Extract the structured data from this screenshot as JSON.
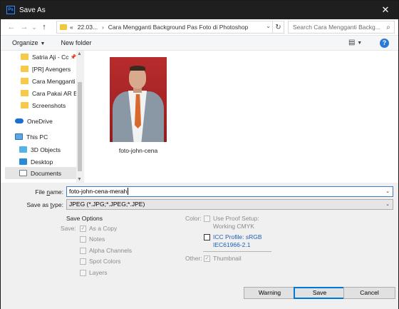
{
  "window": {
    "title": "Save As",
    "app_icon": "Ps",
    "close_glyph": "✕"
  },
  "nav": {
    "back_glyph": "←",
    "forward_glyph": "→",
    "recent_glyph": "⌄",
    "up_glyph": "↑",
    "breadcrumb": [
      "«",
      "22.03...",
      "Cara Mengganti Background Pas Foto di Photoshop"
    ],
    "search_placeholder": "Search Cara Mengganti Backg..."
  },
  "toolbar": {
    "organize_label": "Organize",
    "new_folder_label": "New folder"
  },
  "sidebar": {
    "items": [
      {
        "label": "Satria Aji - Cc",
        "icon": "folder-icon",
        "pinned": true
      },
      {
        "label": "[PR] Avengers",
        "icon": "folder-icon"
      },
      {
        "label": "Cara Mengganti",
        "icon": "folder-icon"
      },
      {
        "label": "Cara Pakai AR Er",
        "icon": "folder-icon"
      },
      {
        "label": "Screenshots",
        "icon": "folder-icon"
      },
      {
        "label": "OneDrive",
        "icon": "cloud-icon"
      },
      {
        "label": "This PC",
        "icon": "pc-icon"
      },
      {
        "label": "3D Objects",
        "icon": "cube-icon"
      },
      {
        "label": "Desktop",
        "icon": "desktop-icon"
      },
      {
        "label": "Documents",
        "icon": "documents-icon",
        "selected": true
      }
    ]
  },
  "content": {
    "files": [
      {
        "name": "foto-john-cena",
        "icon": "image-thumbnail"
      }
    ]
  },
  "form": {
    "filename_label": "File name:",
    "filename_value": "foto-john-cena-merah",
    "type_label": "Save as type:",
    "type_value": "JPEG (*.JPG;*.JPEG;*.JPE)",
    "save_options_title": "Save Options",
    "save_label": "Save:",
    "as_a_copy": "As a Copy",
    "notes": "Notes",
    "alpha_channels": "Alpha Channels",
    "spot_colors": "Spot Colors",
    "layers": "Layers",
    "color_label": "Color:",
    "use_proof_setup_1": "Use Proof Setup:",
    "use_proof_setup_2": "Working CMYK",
    "icc_profile_1": "ICC Profile:  sRGB",
    "icc_profile_2": "IEC61966-2.1",
    "other_label": "Other:",
    "thumbnail": "Thumbnail"
  },
  "buttons": {
    "warning": "Warning",
    "save": "Save",
    "cancel": "Cancel"
  }
}
